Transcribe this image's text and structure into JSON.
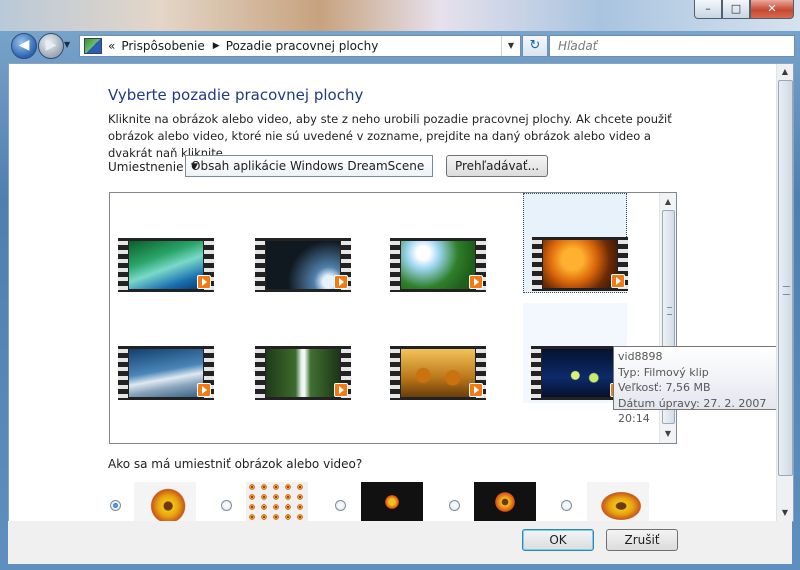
{
  "titlebar": {
    "minimize_icon": "minimize-icon",
    "maximize_icon": "maximize-icon",
    "close_icon": "close-icon"
  },
  "nav": {
    "history_glyph": "«",
    "breadcrumb": [
      "Prispôsobenie",
      "Pozadie pracovnej plochy"
    ],
    "separator": "▶",
    "search_placeholder": "Hľadať"
  },
  "page": {
    "heading": "Vyberte pozadie pracovnej plochy",
    "description": "Kliknite na obrázok alebo video, aby ste z neho urobili pozadie pracovnej plochy. Ak chcete použiť obrázok alebo video, ktoré nie sú uvedené v zozname, prejdite na daný obrázok alebo video a dvakrát naň kliknite.",
    "location_label": "Umiestnenie",
    "location_value": "Obsah aplikácie Windows DreamScene",
    "browse_label": "Prehľadávať...",
    "position_label": "Ako sa má umiestniť obrázok alebo video?"
  },
  "gallery": {
    "items": [
      {
        "thumb": "aurora-green-blue"
      },
      {
        "thumb": "eclipse-light-rays"
      },
      {
        "thumb": "green-leaves-sun"
      },
      {
        "thumb": "autumn-orange-leaves",
        "selected": true
      },
      {
        "thumb": "mountain-peak-ice"
      },
      {
        "thumb": "forest-waterfall"
      },
      {
        "thumb": "golden-flowers"
      },
      {
        "thumb": "night-lanterns",
        "hover": true
      }
    ]
  },
  "tooltip": {
    "name": "vid8898",
    "type": "Typ: Filmový klip",
    "size": "Veľkosť: 7,56 MB",
    "date": "Dátum úpravy: 27. 2. 2007 20:14"
  },
  "positions": {
    "options": [
      "fill",
      "tile",
      "center",
      "fit",
      "stretch"
    ],
    "selected": "fill"
  },
  "footer": {
    "ok": "OK",
    "cancel": "Zrušiť"
  }
}
